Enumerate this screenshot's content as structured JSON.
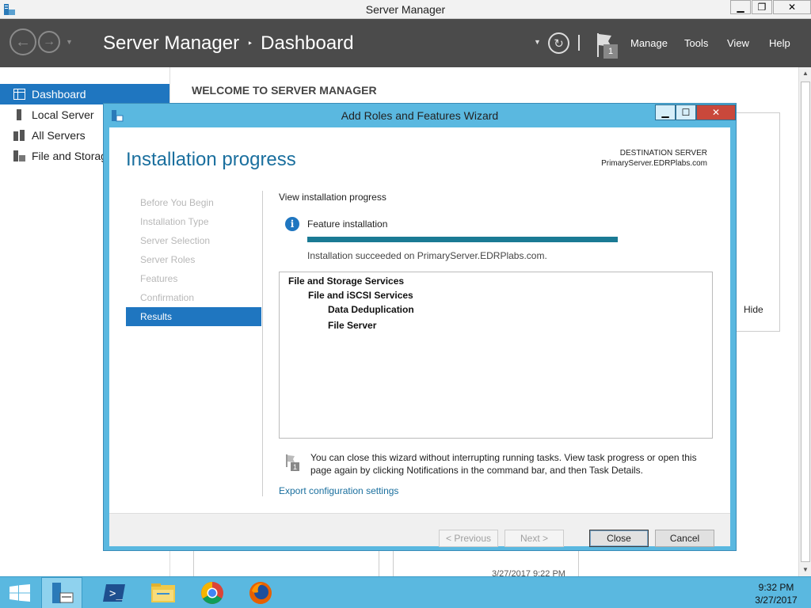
{
  "window": {
    "title": "Server Manager"
  },
  "header": {
    "breadcrumb_root": "Server Manager",
    "breadcrumb_sep": "‣",
    "breadcrumb_page": "Dashboard",
    "notification_count": "1",
    "menu": [
      "Manage",
      "Tools",
      "View",
      "Help"
    ]
  },
  "sidebar": {
    "items": [
      {
        "label": "Dashboard",
        "icon": "dashboard-icon",
        "active": true
      },
      {
        "label": "Local Server",
        "icon": "server-icon"
      },
      {
        "label": "All Servers",
        "icon": "servers-icon"
      },
      {
        "label": "File and Storag",
        "icon": "file-storage-icon"
      }
    ]
  },
  "main": {
    "welcome": "WELCOME TO SERVER MANAGER",
    "hide_label": "Hide",
    "bg_date": "3/27/2017 9:22 PM"
  },
  "wizard": {
    "title": "Add Roles and Features Wizard",
    "heading": "Installation progress",
    "destination_label": "DESTINATION SERVER",
    "destination_server": "PrimaryServer.EDRPlabs.com",
    "steps": [
      "Before You Begin",
      "Installation Type",
      "Server Selection",
      "Server Roles",
      "Features",
      "Confirmation",
      "Results"
    ],
    "active_step": 6,
    "progress_title": "View installation progress",
    "feature_label": "Feature installation",
    "progress_percent": 100,
    "status_text": "Installation succeeded on PrimaryServer.EDRPlabs.com.",
    "results": [
      {
        "label": "File and Storage Services",
        "level": 0
      },
      {
        "label": "File and iSCSI Services",
        "level": 1
      },
      {
        "label": "Data Deduplication",
        "level": 2
      },
      {
        "label": "File Server",
        "level": 2
      }
    ],
    "note_line1": "You can close this wizard without interrupting running tasks. View task progress or open this",
    "note_line2": "page again by clicking Notifications in the command bar, and then Task Details.",
    "export_link": "Export configuration settings",
    "buttons": {
      "previous": "< Previous",
      "next": "Next >",
      "close": "Close",
      "cancel": "Cancel"
    }
  },
  "taskbar": {
    "apps": [
      "server-manager-icon",
      "powershell-icon",
      "file-explorer-icon",
      "chrome-icon",
      "firefox-icon"
    ],
    "time": "9:32 PM",
    "date": "3/27/2017"
  },
  "colors": {
    "accent": "#1f76c0",
    "header_bg": "#4b4b4b",
    "wizard_frame": "#5ab8e0",
    "progress": "#1a7a94"
  }
}
